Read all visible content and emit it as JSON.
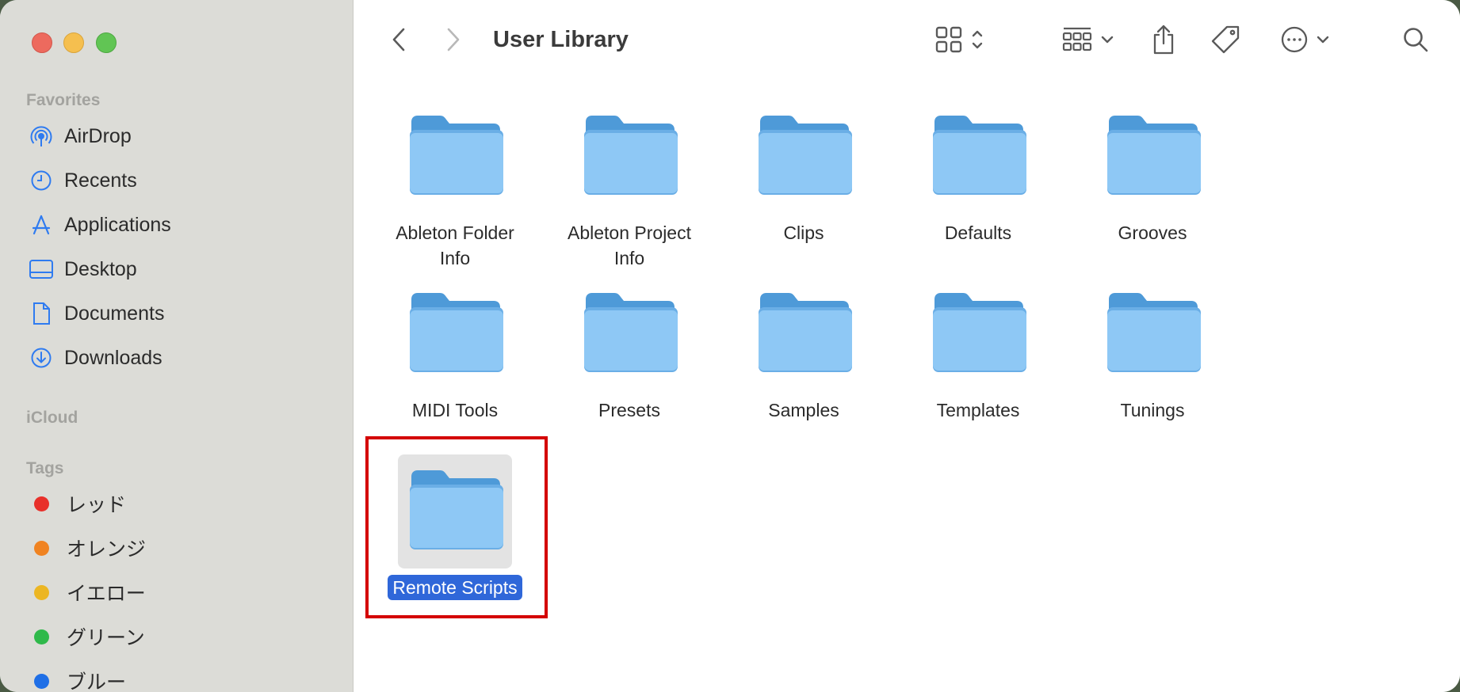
{
  "window": {
    "title": "User Library"
  },
  "sidebar": {
    "favorites_title": "Favorites",
    "favorites": [
      {
        "label": "AirDrop",
        "icon": "airdrop-icon"
      },
      {
        "label": "Recents",
        "icon": "clock-icon"
      },
      {
        "label": "Applications",
        "icon": "applications-icon"
      },
      {
        "label": "Desktop",
        "icon": "desktop-icon"
      },
      {
        "label": "Documents",
        "icon": "document-icon"
      },
      {
        "label": "Downloads",
        "icon": "download-icon"
      }
    ],
    "icloud_title": "iCloud",
    "tags_title": "Tags",
    "tags": [
      {
        "label": "レッド",
        "color": "#e8302a"
      },
      {
        "label": "オレンジ",
        "color": "#f08321"
      },
      {
        "label": "イエロー",
        "color": "#ecb622"
      },
      {
        "label": "グリーン",
        "color": "#2fb94a"
      },
      {
        "label": "ブルー",
        "color": "#1f6fe6"
      }
    ]
  },
  "toolbar": {
    "back_icon": "chevron-left-icon",
    "forward_icon": "chevron-right-icon",
    "view_icon": "grid-view-icon",
    "group_icon": "group-icon",
    "share_icon": "share-icon",
    "tag_icon": "tag-icon",
    "more_icon": "ellipsis-circle-icon",
    "search_icon": "search-icon"
  },
  "folders": [
    {
      "label": "Ableton Folder Info"
    },
    {
      "label": "Ableton Project Info"
    },
    {
      "label": "Clips"
    },
    {
      "label": "Defaults"
    },
    {
      "label": "Grooves"
    },
    {
      "label": "MIDI Tools"
    },
    {
      "label": "Presets"
    },
    {
      "label": "Samples"
    },
    {
      "label": "Templates"
    },
    {
      "label": "Tunings"
    },
    {
      "label": "Remote Scripts",
      "selected": true
    }
  ],
  "colors": {
    "accent": "#2f67d9",
    "folder": "#8ec8f5",
    "highlight": "#d40000"
  }
}
